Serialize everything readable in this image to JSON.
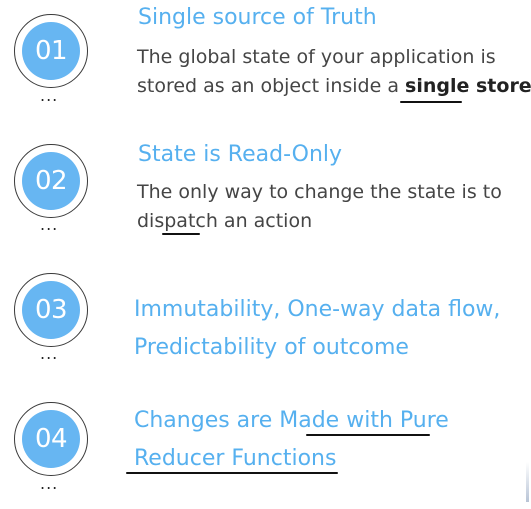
{
  "items": [
    {
      "number": "01",
      "title": "Single source of Truth",
      "text_line1": "The global state of your application is",
      "text_line2_pre": "stored as an object inside a ",
      "text_line2_bold": "single store",
      "text_line2_post": "."
    },
    {
      "number": "02",
      "title": "State is Read-Only",
      "text_line1": "The only way to change the state is to",
      "text_line2": "dispatch an action"
    },
    {
      "number": "03",
      "line1": "Immutability, One-way data flow,",
      "line2": "Predictability of outcome"
    },
    {
      "number": "04",
      "line1": "Changes are Made with Pure",
      "line2": "Reducer Functions"
    }
  ],
  "dots": "...",
  "colors": {
    "accent": "#56b0ef",
    "badge_fill": "#67b6f2",
    "body_text": "#454545"
  }
}
